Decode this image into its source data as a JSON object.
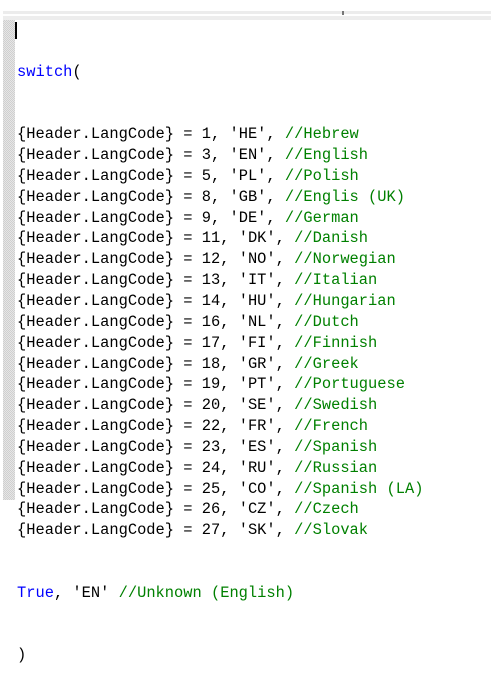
{
  "editor": {
    "language": "formula",
    "colors": {
      "keyword": "#0000ff",
      "comment": "#008000",
      "text": "#000000"
    },
    "open_line": {
      "keyword": "switch",
      "rest": "("
    },
    "cases": [
      {
        "field": "{Header.LangCode}",
        "op": " = ",
        "code": "1",
        "value": "'HE'",
        "comment": "//Hebrew"
      },
      {
        "field": "{Header.LangCode}",
        "op": " = ",
        "code": "3",
        "value": "'EN'",
        "comment": "//English"
      },
      {
        "field": "{Header.LangCode}",
        "op": " = ",
        "code": "5",
        "value": "'PL'",
        "comment": "//Polish"
      },
      {
        "field": "{Header.LangCode}",
        "op": " = ",
        "code": "8",
        "value": "'GB'",
        "comment": "//Englis (UK)"
      },
      {
        "field": "{Header.LangCode}",
        "op": " = ",
        "code": "9",
        "value": "'DE'",
        "comment": "//German"
      },
      {
        "field": "{Header.LangCode}",
        "op": " = ",
        "code": "11",
        "value": "'DK'",
        "comment": "//Danish"
      },
      {
        "field": "{Header.LangCode}",
        "op": " = ",
        "code": "12",
        "value": "'NO'",
        "comment": "//Norwegian"
      },
      {
        "field": "{Header.LangCode}",
        "op": " = ",
        "code": "13",
        "value": "'IT'",
        "comment": "//Italian"
      },
      {
        "field": "{Header.LangCode}",
        "op": " = ",
        "code": "14",
        "value": "'HU'",
        "comment": "//Hungarian"
      },
      {
        "field": "{Header.LangCode}",
        "op": " = ",
        "code": "16",
        "value": "'NL'",
        "comment": "//Dutch"
      },
      {
        "field": "{Header.LangCode}",
        "op": " = ",
        "code": "17",
        "value": "'FI'",
        "comment": "//Finnish"
      },
      {
        "field": "{Header.LangCode}",
        "op": " = ",
        "code": "18",
        "value": "'GR'",
        "comment": "//Greek"
      },
      {
        "field": "{Header.LangCode}",
        "op": " = ",
        "code": "19",
        "value": "'PT'",
        "comment": "//Portuguese"
      },
      {
        "field": "{Header.LangCode}",
        "op": " = ",
        "code": "20",
        "value": "'SE'",
        "comment": "//Swedish"
      },
      {
        "field": "{Header.LangCode}",
        "op": " = ",
        "code": "22",
        "value": "'FR'",
        "comment": "//French"
      },
      {
        "field": "{Header.LangCode}",
        "op": " = ",
        "code": "23",
        "value": "'ES'",
        "comment": "//Spanish"
      },
      {
        "field": "{Header.LangCode}",
        "op": " = ",
        "code": "24",
        "value": "'RU'",
        "comment": "//Russian"
      },
      {
        "field": "{Header.LangCode}",
        "op": " = ",
        "code": "25",
        "value": "'CO'",
        "comment": "//Spanish (LA)"
      },
      {
        "field": "{Header.LangCode}",
        "op": " = ",
        "code": "26",
        "value": "'CZ'",
        "comment": "//Czech"
      },
      {
        "field": "{Header.LangCode}",
        "op": " = ",
        "code": "27",
        "value": "'SK'",
        "comment": "//Slovak"
      }
    ],
    "default_line": {
      "keyword": "True",
      "rest": ", 'EN' ",
      "comment": "//Unknown (English)"
    },
    "close_line": ")"
  }
}
